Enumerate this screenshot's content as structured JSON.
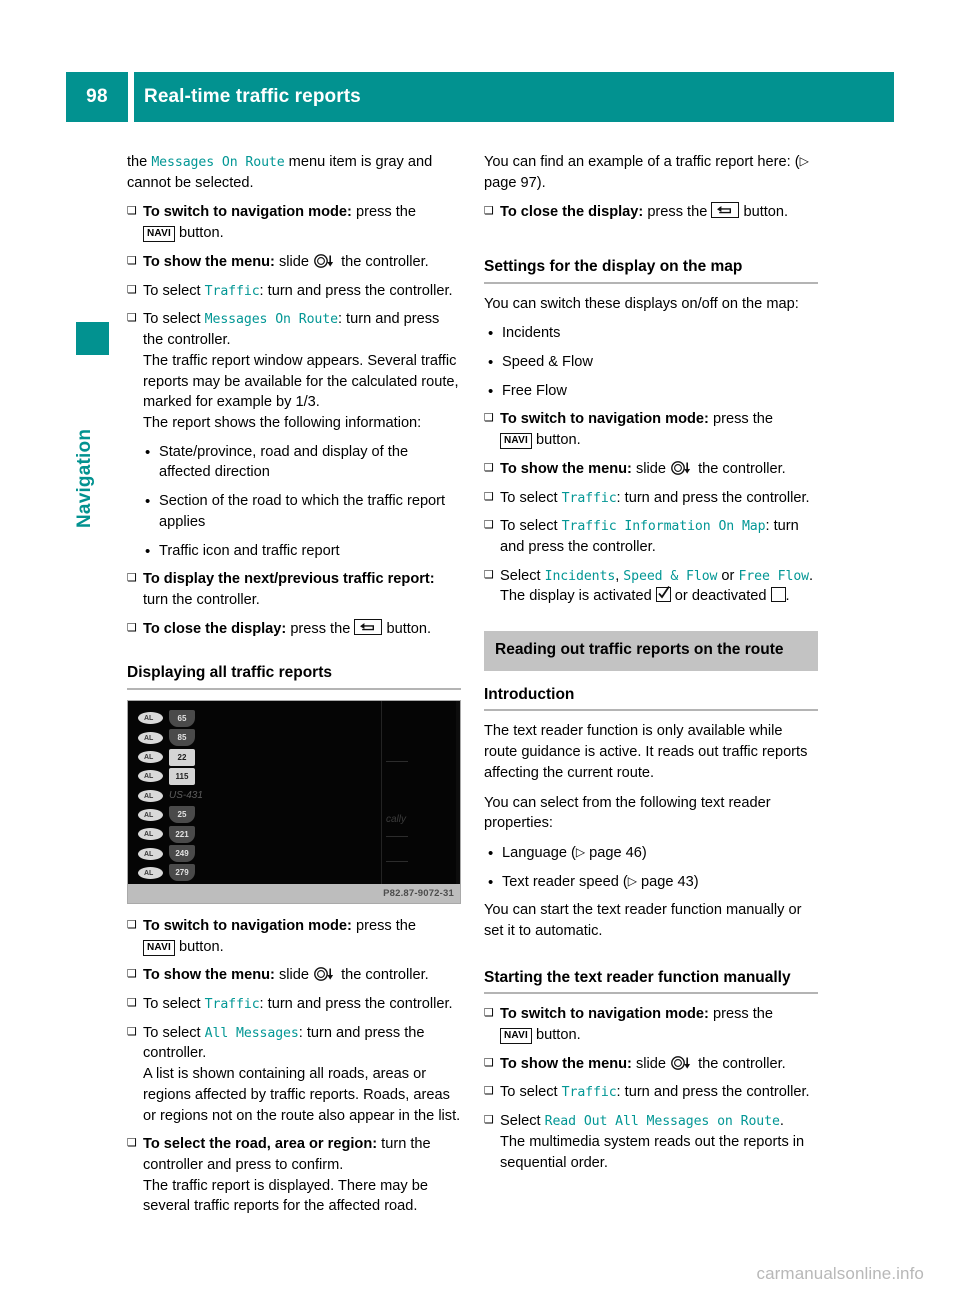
{
  "header": {
    "page_number": "98",
    "title": "Real-time traffic reports",
    "accent_color": "#029290"
  },
  "sidebar": {
    "chapter_label": "Navigation",
    "tab_color": "#029290"
  },
  "left_column": {
    "intro": {
      "before": "the ",
      "menu_item": "Messages On Route",
      "after": " menu item is gray and cannot be selected."
    },
    "steps": [
      {
        "bold": "To switch to navigation mode:",
        "rest": " press the ",
        "key": "NAVI",
        "tail": " button."
      },
      {
        "bold": "To show the menu:",
        "rest": " slide ",
        "glyph": "controller-slide-down-icon",
        "tail": " the controller."
      },
      {
        "bold": "",
        "lead": "To select ",
        "menu_item": "Traffic",
        "tail": ": turn and press the controller."
      },
      {
        "bold": "",
        "lead": "To select ",
        "menu_item": "Messages On Route",
        "tail": ": turn and press the controller.",
        "note": "The traffic report window appears. Several traffic reports may be available for the calculated route, marked for example by 1/3.",
        "note2": "The report shows the following information:"
      }
    ],
    "bullets": [
      "State/province, road and display of the affected direction",
      "Section of the road to which the traffic report applies",
      "Traffic icon and traffic report"
    ],
    "steps2": [
      {
        "bold": "To display the next/previous traffic report:",
        "rest": " turn the controller."
      },
      {
        "bold": "To close the display:",
        "rest": " press the ",
        "key": "back-button-icon",
        "tail": " button."
      }
    ],
    "section_heading": "Displaying all traffic reports",
    "figure": {
      "caption_code": "P82.87-9072-31",
      "rows": [
        {
          "badge": "AL",
          "shield": "65",
          "style": "dark"
        },
        {
          "badge": "AL",
          "shield": "85",
          "style": "dark"
        },
        {
          "badge": "AL",
          "shield": "22",
          "style": "light"
        },
        {
          "badge": "AL",
          "shield": "115",
          "style": "light"
        },
        {
          "badge": "AL",
          "shield": "US-431",
          "style": "text"
        },
        {
          "badge": "AL",
          "shield": "25",
          "style": "dark"
        },
        {
          "badge": "AL",
          "shield": "221",
          "style": "dark"
        },
        {
          "badge": "AL",
          "shield": "249",
          "style": "dark"
        },
        {
          "badge": "AL",
          "shield": "279",
          "style": "dark"
        }
      ],
      "side_word": "cally"
    },
    "steps3": [
      {
        "bold": "To switch to navigation mode:",
        "rest": " press the ",
        "key": "NAVI",
        "tail": " button."
      },
      {
        "bold": "To show the menu:",
        "rest": " slide ",
        "glyph": "controller-slide-down-icon",
        "tail": " the controller."
      },
      {
        "lead": "To select ",
        "menu_item": "Traffic",
        "tail": ": turn and press the controller."
      },
      {
        "lead": "To select ",
        "menu_item": "All Messages",
        "tail": ": turn and press the controller.",
        "note": "A list is shown containing all roads, areas or regions affected by traffic reports. Roads, areas or regions not on the route also appear in the list."
      },
      {
        "bold": "To select the road, area or region:",
        "rest": " turn the controller and press to confirm.",
        "note": "The traffic report is displayed. There may be several traffic reports for the affected road."
      }
    ]
  },
  "right_column": {
    "intro_para": "You can find an example of a traffic report here: (",
    "intro_pageref": " page 97).",
    "close_step": {
      "bold": "To close the display:",
      "rest": " press the ",
      "key": "back-button-icon",
      "tail": " button."
    },
    "heading_map_settings": "Settings for the display on the map",
    "map_intro": "You can switch these displays on/off on the map:",
    "map_bullets": [
      "Incidents",
      "Speed & Flow",
      "Free Flow"
    ],
    "map_steps": [
      {
        "bold": "To switch to navigation mode:",
        "rest": " press the ",
        "key": "NAVI",
        "tail": " button."
      },
      {
        "bold": "To show the menu:",
        "rest": " slide ",
        "glyph": "controller-slide-down-icon",
        "tail": " the controller."
      },
      {
        "lead": "To select ",
        "menu_item": "Traffic",
        "tail": ": turn and press the controller."
      },
      {
        "lead": "To select ",
        "menu_item": "Traffic Information On Map",
        "tail": ": turn and press the controller."
      }
    ],
    "select_step": {
      "lead": "Select ",
      "item1": "Incidents",
      "sep1": ", ",
      "item2": "Speed & Flow",
      "sep2": " or ",
      "item3": "Free Flow",
      "period": ".",
      "note_a": "The display is activated ",
      "note_b": " or deactivated ",
      "note_c": "."
    },
    "chapter_box": "Reading out traffic reports on the route",
    "heading_introduction": "Introduction",
    "intro_body1": "The text reader function is only available while route guidance is active. It reads out traffic reports affecting the current route.",
    "intro_body2": "You can select from the following text reader properties:",
    "reader_bullets": [
      {
        "label": "Language (",
        "pageref": " page 46)"
      },
      {
        "label": "Text reader speed (",
        "pageref": " page 43)"
      }
    ],
    "intro_body3": "You can start the text reader function manually or set it to automatic.",
    "heading_starting": "Starting the text reader function manually",
    "start_steps": [
      {
        "bold": "To switch to navigation mode:",
        "rest": " press the ",
        "key": "NAVI",
        "tail": " button."
      },
      {
        "bold": "To show the menu:",
        "rest": " slide ",
        "glyph": "controller-slide-down-icon",
        "tail": " the controller."
      },
      {
        "lead": "To select ",
        "menu_item": "Traffic",
        "tail": ": turn and press the controller."
      },
      {
        "lead": "Select ",
        "menu_item": "Read Out All Messages on Route",
        "tail": ".",
        "note": "The multimedia system reads out the reports in sequential order."
      }
    ]
  },
  "watermark": "carmanualsonline.info",
  "glyphs": {
    "step_marker": "X",
    "dot_marker": "R",
    "page_arrow": "Y"
  }
}
